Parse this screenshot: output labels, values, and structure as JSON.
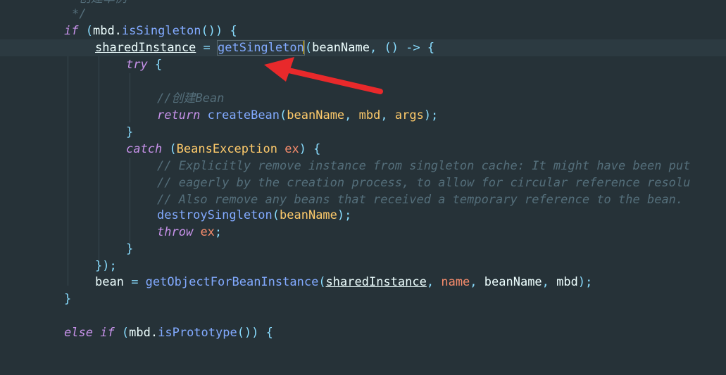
{
  "editor": {
    "colors": {
      "background": "#263238",
      "current_line": "#2c3a41",
      "keyword": "#c792ea",
      "function": "#82aaff",
      "type": "#ffcb6b",
      "parameter": "#f78c6c",
      "punctuation": "#89ddff",
      "comment": "#546e7a",
      "annotation_arrow": "#e8292b"
    },
    "lines": {
      "l0": {
        "comment": "创建单例"
      },
      "l1": {
        "comment_end": "*/"
      },
      "l2": {
        "kw": "if",
        "p1": " (",
        "t1": "mbd.",
        "f1": "isSingleton",
        "p2": "()) {"
      },
      "l3": {
        "t1": "sharedInstance",
        "t2": " = ",
        "f1": "getSingleton",
        "p1": "(",
        "t3": "beanName",
        "p2": ", () -> {"
      },
      "l4": {
        "kw": "try",
        "p1": " {"
      },
      "l5": {},
      "l6": {
        "comment": "//创建Bean"
      },
      "l7": {
        "kw": "return",
        "f1": "createBean",
        "p1": "(",
        "a1": "beanName",
        "p2": ", ",
        "a2": "mbd",
        "p3": ", ",
        "a3": "args",
        "p4": ");"
      },
      "l8": {
        "p1": "}"
      },
      "l9": {
        "kw": "catch",
        "p1": " (",
        "ty": "BeansException",
        "v": "ex",
        "p2": ") {"
      },
      "l10": {
        "comment": "// Explicitly remove instance from singleton cache: It might have been put"
      },
      "l11": {
        "comment": "// eagerly by the creation process, to allow for circular reference resolu"
      },
      "l12": {
        "comment": "// Also remove any beans that received a temporary reference to the bean."
      },
      "l13": {
        "f1": "destroySingleton",
        "p1": "(",
        "a1": "beanName",
        "p2": ");"
      },
      "l14": {
        "kw": "throw",
        "v": "ex",
        "p1": ";"
      },
      "l15": {
        "p1": "}"
      },
      "l16": {
        "p1": "});"
      },
      "l17": {
        "t1": "bean",
        "t2": " = ",
        "f1": "getObjectForBeanInstance",
        "p1": "(",
        "a1": "sharedInstance",
        "p2": ", ",
        "a2": "name",
        "p3": ", ",
        "a3": "beanName",
        "p4": ", ",
        "a4": "mbd",
        "p5": ");"
      },
      "l18": {
        "p1": "}"
      },
      "l19": {},
      "l20": {
        "kw1": "else",
        "kw2": "if",
        "p1": " (",
        "t1": "mbd.",
        "f1": "isPrototype",
        "p2": "()) {"
      }
    }
  }
}
